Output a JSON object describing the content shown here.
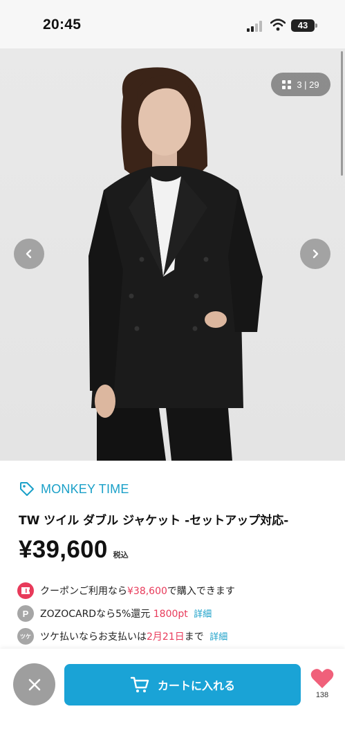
{
  "status_bar": {
    "time": "20:45",
    "battery": "43",
    "icons": [
      "signal-icon",
      "wifi-icon",
      "battery-icon"
    ]
  },
  "gallery": {
    "counter": "3 | 29",
    "icons": [
      "grid-icon",
      "chevron-left-icon",
      "chevron-right-icon"
    ]
  },
  "product": {
    "brand": "MONKEY TIME",
    "brand_icon": "tag-icon",
    "title": "TW ツイル ダブル ジャケット -セットアップ対応-",
    "price": "¥39,600",
    "tax_label": "税込"
  },
  "benefits": {
    "coupon": {
      "prefix": "クーポンご利用なら",
      "price": "¥38,600",
      "suffix": "で購入できます",
      "icon": "coupon-icon"
    },
    "card": {
      "badge": "P",
      "text": "ZOZOCARDなら5%還元",
      "points": "1800pt",
      "link": "詳細"
    },
    "tsuke": {
      "badge": "ツケ",
      "prefix": "ツケ払いならお支払いは",
      "date": "2月21日",
      "suffix": "まで",
      "link": "詳細"
    }
  },
  "actions": {
    "cart_label": "カートに入れる",
    "favorite_count": "138",
    "icons": [
      "close-icon",
      "cart-icon",
      "heart-icon"
    ]
  },
  "colors": {
    "accent": "#1aa3d6",
    "brand_text": "#1aa0c8",
    "coupon_red": "#e83a5a",
    "heart": "#f0607a"
  }
}
